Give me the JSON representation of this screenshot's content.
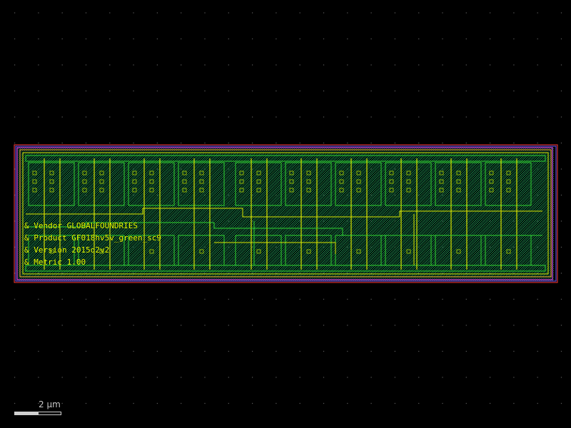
{
  "layout": {
    "background": "#000000",
    "grid_dot_color": "#5a5a5a",
    "layer_colors": {
      "outline_red": "#ff3a3a",
      "outline_magenta": "#ff40ff",
      "outline_blue": "#6a5cff",
      "outline_orange": "#ffb030",
      "diffusion_green": "#2fd02f",
      "poly_yellow": "#d8e000",
      "metal_teal": "#1a9a7a",
      "contact": "#b0d000"
    },
    "text_labels": [
      "& Vendor GLOBALFOUNDRIES",
      "& Product GF018hv5v_green_sc9",
      "& Version 2015q2v2",
      "& Metric 1.00"
    ],
    "label_color": "#e6ff00"
  },
  "scale_bar": {
    "label": "2 μm",
    "color": "#d0d0d0"
  }
}
